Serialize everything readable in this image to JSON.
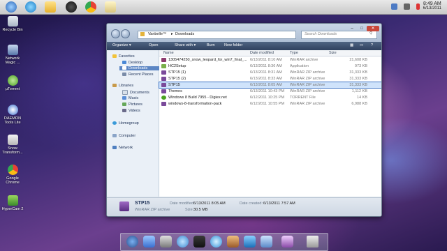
{
  "colors": {
    "accent": "#3d74c4",
    "selection": "#cfe3fb",
    "toolbar": "#2f415e"
  },
  "taskbar": {
    "icons": [
      "start-orb-icon",
      "ie-icon",
      "folder-icon",
      "media-icon",
      "chrome-icon",
      "hypercam-icon"
    ],
    "clock": {
      "time": "8:49 AM",
      "date": "6/13/2011"
    }
  },
  "desktop": {
    "icons": [
      {
        "label": "Recycle Bin",
        "icon": "recycle-bin-icon"
      },
      {
        "label": "Network Magic ...",
        "icon": "network-magic-icon"
      },
      {
        "label": "µTorrent",
        "icon": "utorrent-icon"
      },
      {
        "label": "DAEMON Tools Lite",
        "icon": "daemon-tools-icon"
      },
      {
        "label": "Snow Transform...",
        "icon": "snow-transform-icon"
      },
      {
        "label": "Google Chrome",
        "icon": "chrome-icon"
      },
      {
        "label": "HyperCam 2",
        "icon": "hypercam-icon"
      }
    ]
  },
  "window": {
    "breadcrumb": [
      "Vanbelle™",
      "Downloads"
    ],
    "search_placeholder": "Search Downloads",
    "controls": {
      "minimize": "–",
      "maximize": "□",
      "close": "✕"
    },
    "toolbar": [
      "Organize ▾",
      "Open",
      "Share with ▾",
      "Burn",
      "New folder"
    ],
    "sidebar": {
      "favorites": {
        "title": "Favorites",
        "items": [
          "Desktop",
          "Downloads",
          "Recent Places"
        ],
        "selected": "Downloads"
      },
      "libraries": {
        "title": "Libraries",
        "items": [
          "Documents",
          "Music",
          "Pictures",
          "Videos"
        ]
      },
      "homegroup": "Homegroup",
      "computer": "Computer",
      "network": "Network"
    },
    "columns": {
      "name": "Name",
      "date": "Date modified",
      "type": "Type",
      "size": "Size"
    },
    "files": [
      {
        "name": "1305474250_snow_leopard_for_win7_final_...",
        "date": "6/13/2011 8:10 AM",
        "type": "WinRAR archive",
        "size": "21,608 KB",
        "icon": "rar-icon"
      },
      {
        "name": "HC2Setup",
        "date": "6/13/2011 8:36 AM",
        "type": "Application",
        "size": "973 KB",
        "icon": "setup-icon"
      },
      {
        "name": "STP15 (1)",
        "date": "6/13/2011 8:31 AM",
        "type": "WinRAR ZIP archive",
        "size": "31,333 KB",
        "icon": "zip-icon"
      },
      {
        "name": "STP15 (2)",
        "date": "6/13/2011 8:33 AM",
        "type": "WinRAR ZIP archive",
        "size": "31,333 KB",
        "icon": "zip-icon"
      },
      {
        "name": "STP15",
        "date": "6/13/2011 8:05 AM",
        "type": "WinRAR ZIP archive",
        "size": "31,333 KB",
        "icon": "zip-icon",
        "selected": true
      },
      {
        "name": "Themes",
        "date": "6/13/2011 10:43 PM",
        "type": "WinRAR ZIP archive",
        "size": "1,112 KB",
        "icon": "zip-icon"
      },
      {
        "name": "Windows 8 Build 7955 - Digiex.net",
        "date": "6/12/2011 10:25 PM",
        "type": "TORRENT File",
        "size": "14 KB",
        "icon": "torrent-icon"
      },
      {
        "name": "windows-8-transformation-pack",
        "date": "6/12/2011 10:55 PM",
        "type": "WinRAR ZIP archive",
        "size": "6,988 KB",
        "icon": "zip-icon"
      }
    ],
    "details": {
      "name": "STP15",
      "type": "WinRAR ZIP archive",
      "date_label": "Date modified:",
      "date": "6/13/2011 8:05 AM",
      "created_label": "Date created:",
      "created": "6/13/2011 7:57 AM",
      "size_label": "Size:",
      "size": "30.5 MB"
    }
  },
  "dock": {
    "icons": [
      "launchpad-icon",
      "finder-icon",
      "calculator-icon",
      "ichat-icon",
      "dashboard-icon",
      "ituneslike-icon",
      "home-icon",
      "appstore-icon",
      "display-icon",
      "maps-icon",
      "trash-icon"
    ]
  }
}
